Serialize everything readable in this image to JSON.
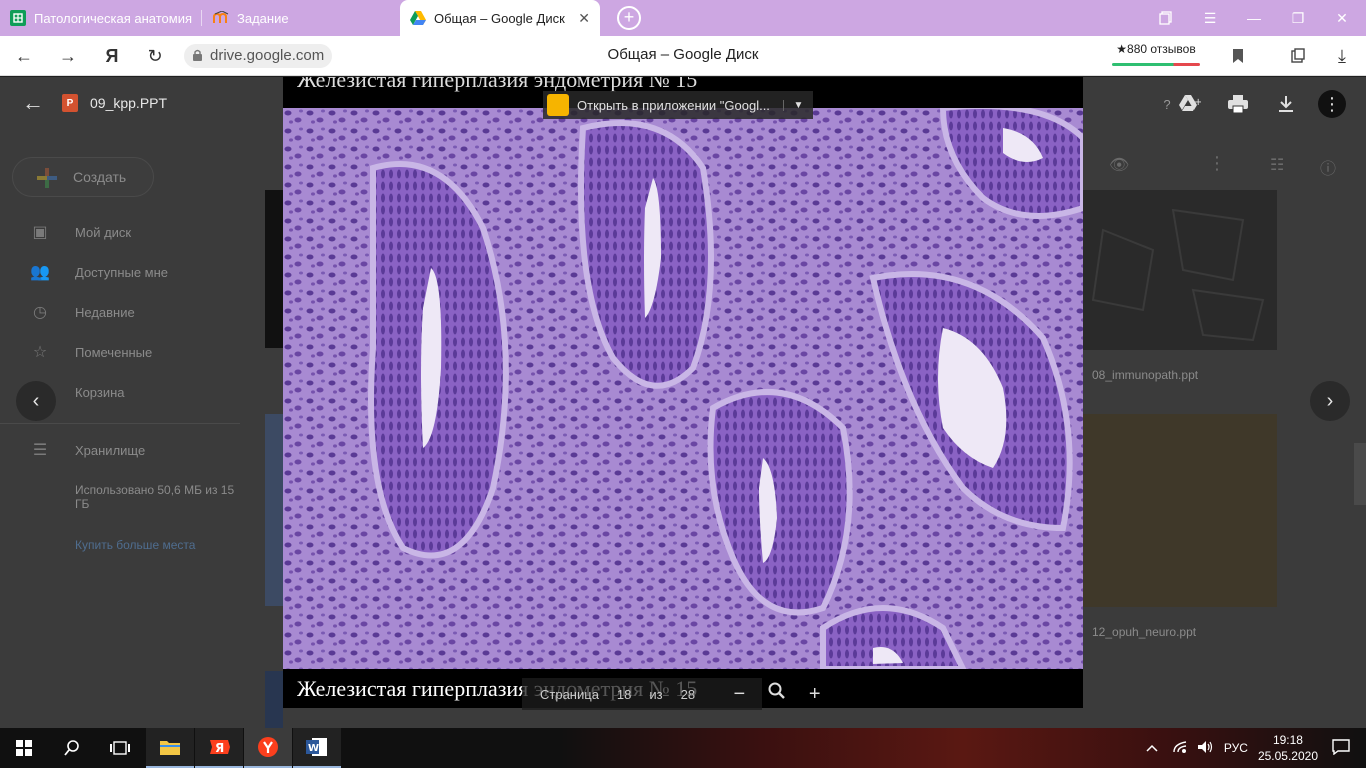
{
  "tabs": [
    {
      "title": "Патологическая анатомия",
      "favicon": "sheets-icon",
      "color": "#0f9d58"
    },
    {
      "title": "Задание",
      "favicon": "moodle-icon",
      "color": "#f98012"
    },
    {
      "title": "Общая – Google Диск",
      "favicon": "google-drive-icon",
      "active": true
    }
  ],
  "browser": {
    "url": "drive.google.com",
    "page_title": "Общая – Google Диск",
    "reviews": "★880 отзывов"
  },
  "drive": {
    "create_label": "Создать",
    "nav": [
      {
        "label": "Мой диск",
        "icon": "drive-folder-icon"
      },
      {
        "label": "Доступные мне",
        "icon": "people-icon"
      },
      {
        "label": "Недавние",
        "icon": "clock-icon"
      },
      {
        "label": "Помеченные",
        "icon": "star-icon"
      },
      {
        "label": "Корзина",
        "icon": "trash-icon"
      }
    ],
    "storage_label": "Хранилище",
    "storage_used": "Использовано 50,6 МБ из 15 ГБ",
    "buy_more": "Купить больше места",
    "files": [
      "08_immunopath.ppt",
      "12_opuh_neuro.ppt"
    ]
  },
  "viewer": {
    "filename": "09_kpp.PPT",
    "file_badge": "P",
    "open_with": "Открыть в приложении \"Googl...",
    "slide_top_text": "Железистая гиперплазия эндометрия № 15",
    "slide_caption": "Железистая гиперплазия эндометрия № 15",
    "page_label": "Страница",
    "page_current": "18",
    "page_of": "из",
    "page_total": "28"
  },
  "taskbar": {
    "lang": "РУС",
    "time": "19:18",
    "date": "25.05.2020"
  }
}
